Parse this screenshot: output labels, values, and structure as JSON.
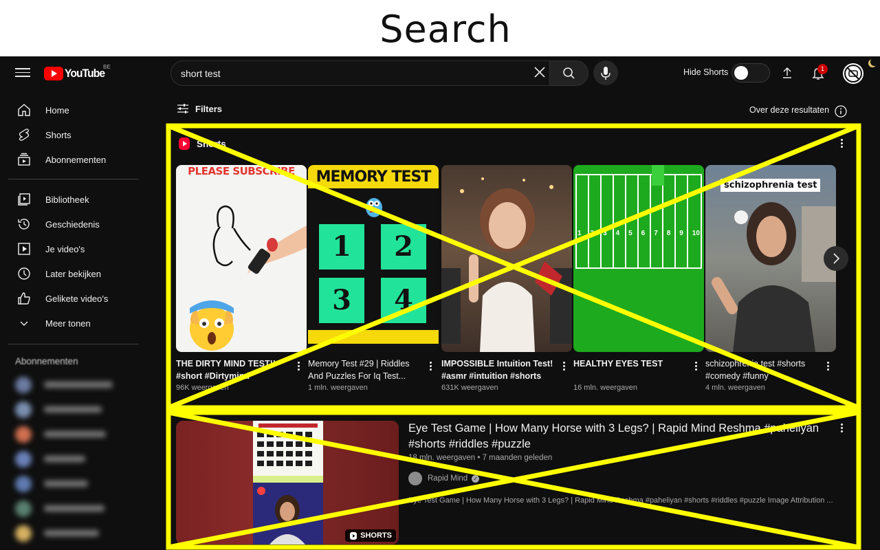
{
  "page": {
    "title": "Search"
  },
  "header": {
    "logo_text": "YouTube",
    "region": "BE",
    "search_value": "short test",
    "hide_shorts_label": "Hide Shorts",
    "notification_count": "1"
  },
  "sidebar": {
    "items": [
      {
        "label": "Home",
        "icon": "home-icon"
      },
      {
        "label": "Shorts",
        "icon": "shorts-icon"
      },
      {
        "label": "Abonnementen",
        "icon": "subscriptions-icon"
      },
      {
        "label": "Bibliotheek",
        "icon": "library-icon"
      },
      {
        "label": "Geschiedenis",
        "icon": "history-icon"
      },
      {
        "label": "Je video's",
        "icon": "your-videos-icon"
      },
      {
        "label": "Later bekijken",
        "icon": "watch-later-icon"
      },
      {
        "label": "Gelikete video's",
        "icon": "liked-icon"
      },
      {
        "label": "Meer tonen",
        "icon": "chevron-down-icon"
      }
    ],
    "subscriptions_heading": "Abonnementen"
  },
  "filters": {
    "label": "Filters",
    "about_label": "Over deze resultaten"
  },
  "shorts": {
    "section_title": "Shorts",
    "items": [
      {
        "title": "THE DIRTY MIND TEST!! #short #Dirtymind #Drawing...",
        "views": "96K weergaven",
        "overlay": "PLEASE SUBSCRIBE"
      },
      {
        "title": "Memory Test #29 | Riddles And Puzzles For Iq Test...",
        "views": "1 mln. weergaven",
        "overlay": "MEMORY TEST"
      },
      {
        "title": "IMPOSSIBLE Intuition Test! #asmr #intuition #shorts",
        "views": "631K weergaven",
        "overlay": ""
      },
      {
        "title": "HEALTHY EYES TEST",
        "views": "16 mln. weergaven",
        "overlay": ""
      },
      {
        "title": "schizophrenia test #shorts #comedy #funny",
        "views": "4 mln. weergaven",
        "overlay": "schizophrenia test"
      }
    ],
    "memory_numbers": [
      "1",
      "2",
      "3",
      "4"
    ],
    "field_numbers": [
      "1",
      "2",
      "3",
      "4",
      "5",
      "6",
      "7",
      "8",
      "9",
      "10"
    ]
  },
  "video": {
    "title": "Eye Test Game | How Many Horse with 3 Legs? | Rapid Mind Reshma #paheliyan #shorts #riddles #puzzle",
    "meta": "18 mln. weergaven • 7 maanden geleden",
    "channel": "Rapid Mind",
    "description": "Eye Test Game | How Many Horse with 3 Legs? | Rapid Mind Reshma #paheliyan #shorts #riddles #puzzle Image Attribution ...",
    "badge": "SHORTS"
  },
  "colors": {
    "background": "#0f0f0f",
    "brand": "#ff0000",
    "annotation": "#ffff00"
  }
}
